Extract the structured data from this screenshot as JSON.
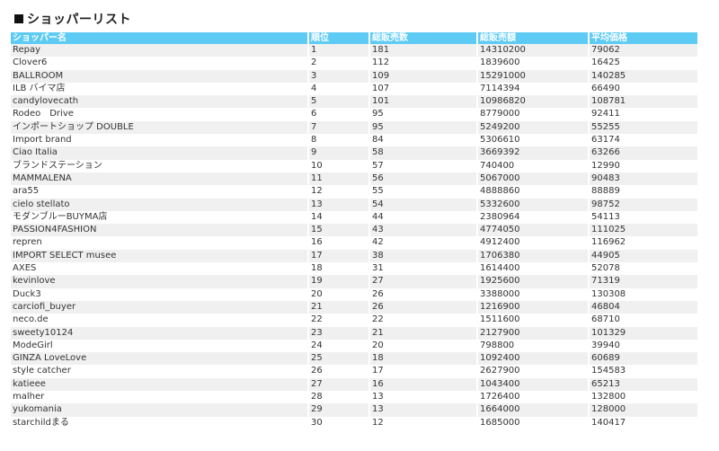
{
  "title": "ショッパーリスト",
  "columns": [
    "ショッパー名",
    "順位",
    "総販売数",
    "総販売額",
    "平均価格"
  ],
  "rows": [
    [
      "Repay",
      "1",
      "181",
      "14310200",
      "79062"
    ],
    [
      "Clover6",
      "2",
      "112",
      "1839600",
      "16425"
    ],
    [
      "BALLROOM",
      "3",
      "109",
      "15291000",
      "140285"
    ],
    [
      "ILB バイマ店",
      "4",
      "107",
      "7114394",
      "66490"
    ],
    [
      "candylovecath",
      "5",
      "101",
      "10986820",
      "108781"
    ],
    [
      "Rodeo　Drive",
      "6",
      "95",
      "8779000",
      "92411"
    ],
    [
      "インポートショップ DOUBLE",
      "7",
      "95",
      "5249200",
      "55255"
    ],
    [
      "Import brand",
      "8",
      "84",
      "5306610",
      "63174"
    ],
    [
      "Ciao Italia",
      "9",
      "58",
      "3669392",
      "63266"
    ],
    [
      "ブランドステーション",
      "10",
      "57",
      "740400",
      "12990"
    ],
    [
      "MAMMALENA",
      "11",
      "56",
      "5067000",
      "90483"
    ],
    [
      "ara55",
      "12",
      "55",
      "4888860",
      "88889"
    ],
    [
      "cielo stellato",
      "13",
      "54",
      "5332600",
      "98752"
    ],
    [
      "モダンブルーBUYMA店",
      "14",
      "44",
      "2380964",
      "54113"
    ],
    [
      "PASSION4FASHION",
      "15",
      "43",
      "4774050",
      "111025"
    ],
    [
      "repren",
      "16",
      "42",
      "4912400",
      "116962"
    ],
    [
      "IMPORT SELECT musee",
      "17",
      "38",
      "1706380",
      "44905"
    ],
    [
      "AXES",
      "18",
      "31",
      "1614400",
      "52078"
    ],
    [
      "kevinlove",
      "19",
      "27",
      "1925600",
      "71319"
    ],
    [
      "Duck3",
      "20",
      "26",
      "3388000",
      "130308"
    ],
    [
      "carciofi_buyer",
      "21",
      "26",
      "1216900",
      "46804"
    ],
    [
      "neco.de",
      "22",
      "22",
      "1511600",
      "68710"
    ],
    [
      "sweety10124",
      "23",
      "21",
      "2127900",
      "101329"
    ],
    [
      "ModeGirl",
      "24",
      "20",
      "798800",
      "39940"
    ],
    [
      "GINZA LoveLove",
      "25",
      "18",
      "1092400",
      "60689"
    ],
    [
      "style catcher",
      "26",
      "17",
      "2627900",
      "154583"
    ],
    [
      "katieee",
      "27",
      "16",
      "1043400",
      "65213"
    ],
    [
      "malher",
      "28",
      "13",
      "1726400",
      "132800"
    ],
    [
      "yukomania",
      "29",
      "13",
      "1664000",
      "128000"
    ],
    [
      "starchildまる",
      "30",
      "12",
      "1685000",
      "140417"
    ]
  ],
  "colors": {
    "header_bg": "#5ecbf5",
    "header_text": "#ffffff",
    "row_odd": "#f0f0f0",
    "row_even": "#ffffff"
  }
}
